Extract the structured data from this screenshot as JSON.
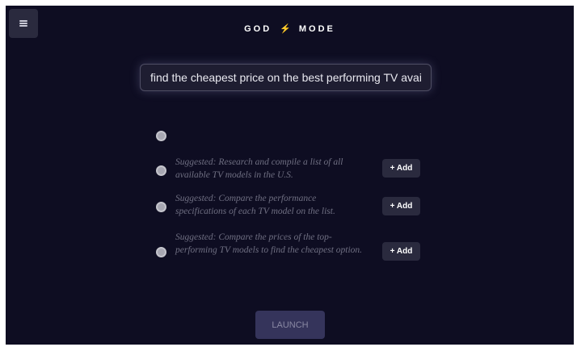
{
  "header": {
    "title_left": "GOD",
    "title_right": "MODE",
    "title_bolt": "⚡"
  },
  "search": {
    "value": "find the cheapest price on the best performing TV available"
  },
  "suggestions": [
    {
      "text": "Suggested: Research and compile a list of all available TV models in the U.S.",
      "add_label": "+ Add"
    },
    {
      "text": "Suggested: Compare the performance specifications of each TV model on the list.",
      "add_label": "+ Add"
    },
    {
      "text": "Suggested: Compare the prices of the top-performing TV models to find the cheapest option.",
      "add_label": "+ Add"
    }
  ],
  "launch_label": "LAUNCH",
  "colors": {
    "background": "#0e0d22",
    "accent_bolt": "#ff8a1f",
    "launch_bg": "#35345b"
  },
  "icons": {
    "menu": "hamburger-menu-icon",
    "bolt": "lightning-bolt-icon"
  }
}
